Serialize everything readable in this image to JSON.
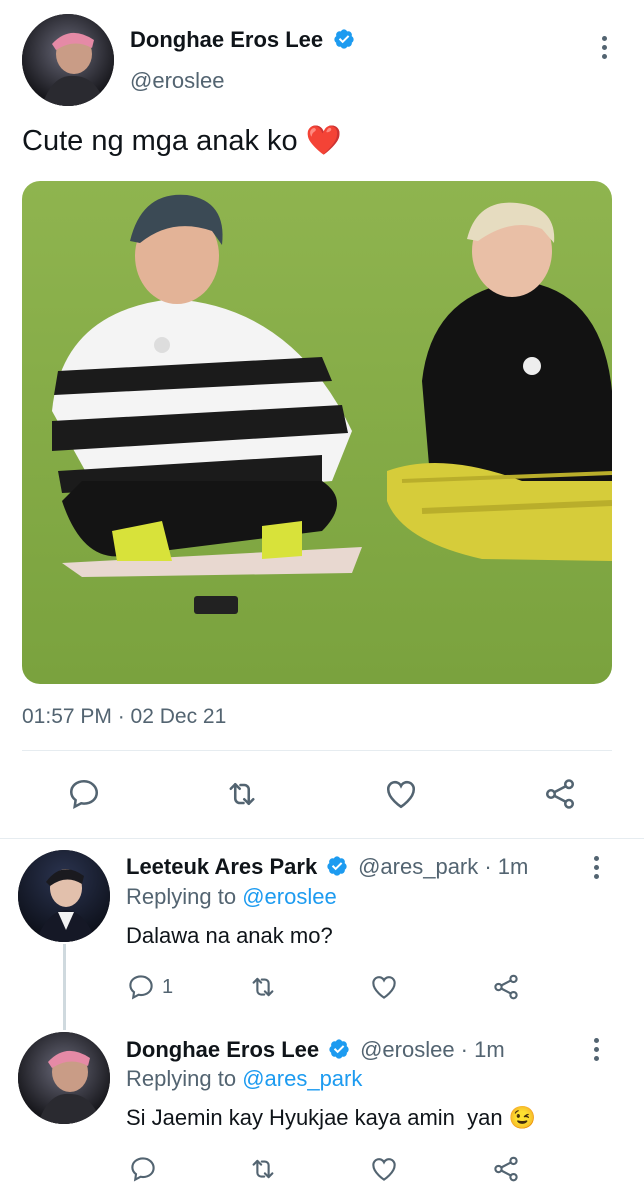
{
  "main_tweet": {
    "author_name": "Donghae Eros Lee",
    "author_handle": "@eroslee",
    "text": "Cute ng mga anak ko",
    "emoji": "❤️",
    "timestamp": "01:57 PM · 02 Dec 21"
  },
  "replies": [
    {
      "author_name": "Leeteuk Ares Park",
      "author_handle": "@ares_park · 1m",
      "replying_prefix": "Replying to",
      "replying_to": "@eroslee",
      "text": "Dalawa na anak mo?",
      "reply_count": "1"
    },
    {
      "author_name": "Donghae Eros Lee",
      "author_handle": "@eroslee · 1m",
      "replying_prefix": "Replying to",
      "replying_to": "@ares_park",
      "text": "Si Jaemin kay Hyukjae kaya amin  yan",
      "emoji": "😉"
    }
  ],
  "icons": {
    "reply": "reply-icon",
    "retweet": "retweet-icon",
    "like": "heart-icon",
    "share": "share-icon",
    "more": "more-icon",
    "verified": "verified-badge-icon"
  },
  "colors": {
    "accent": "#1d9bf0",
    "secondary_text": "#536471",
    "divider": "#e6ecf0",
    "icon": "#536471",
    "heart_emoji": "#e0245e"
  }
}
